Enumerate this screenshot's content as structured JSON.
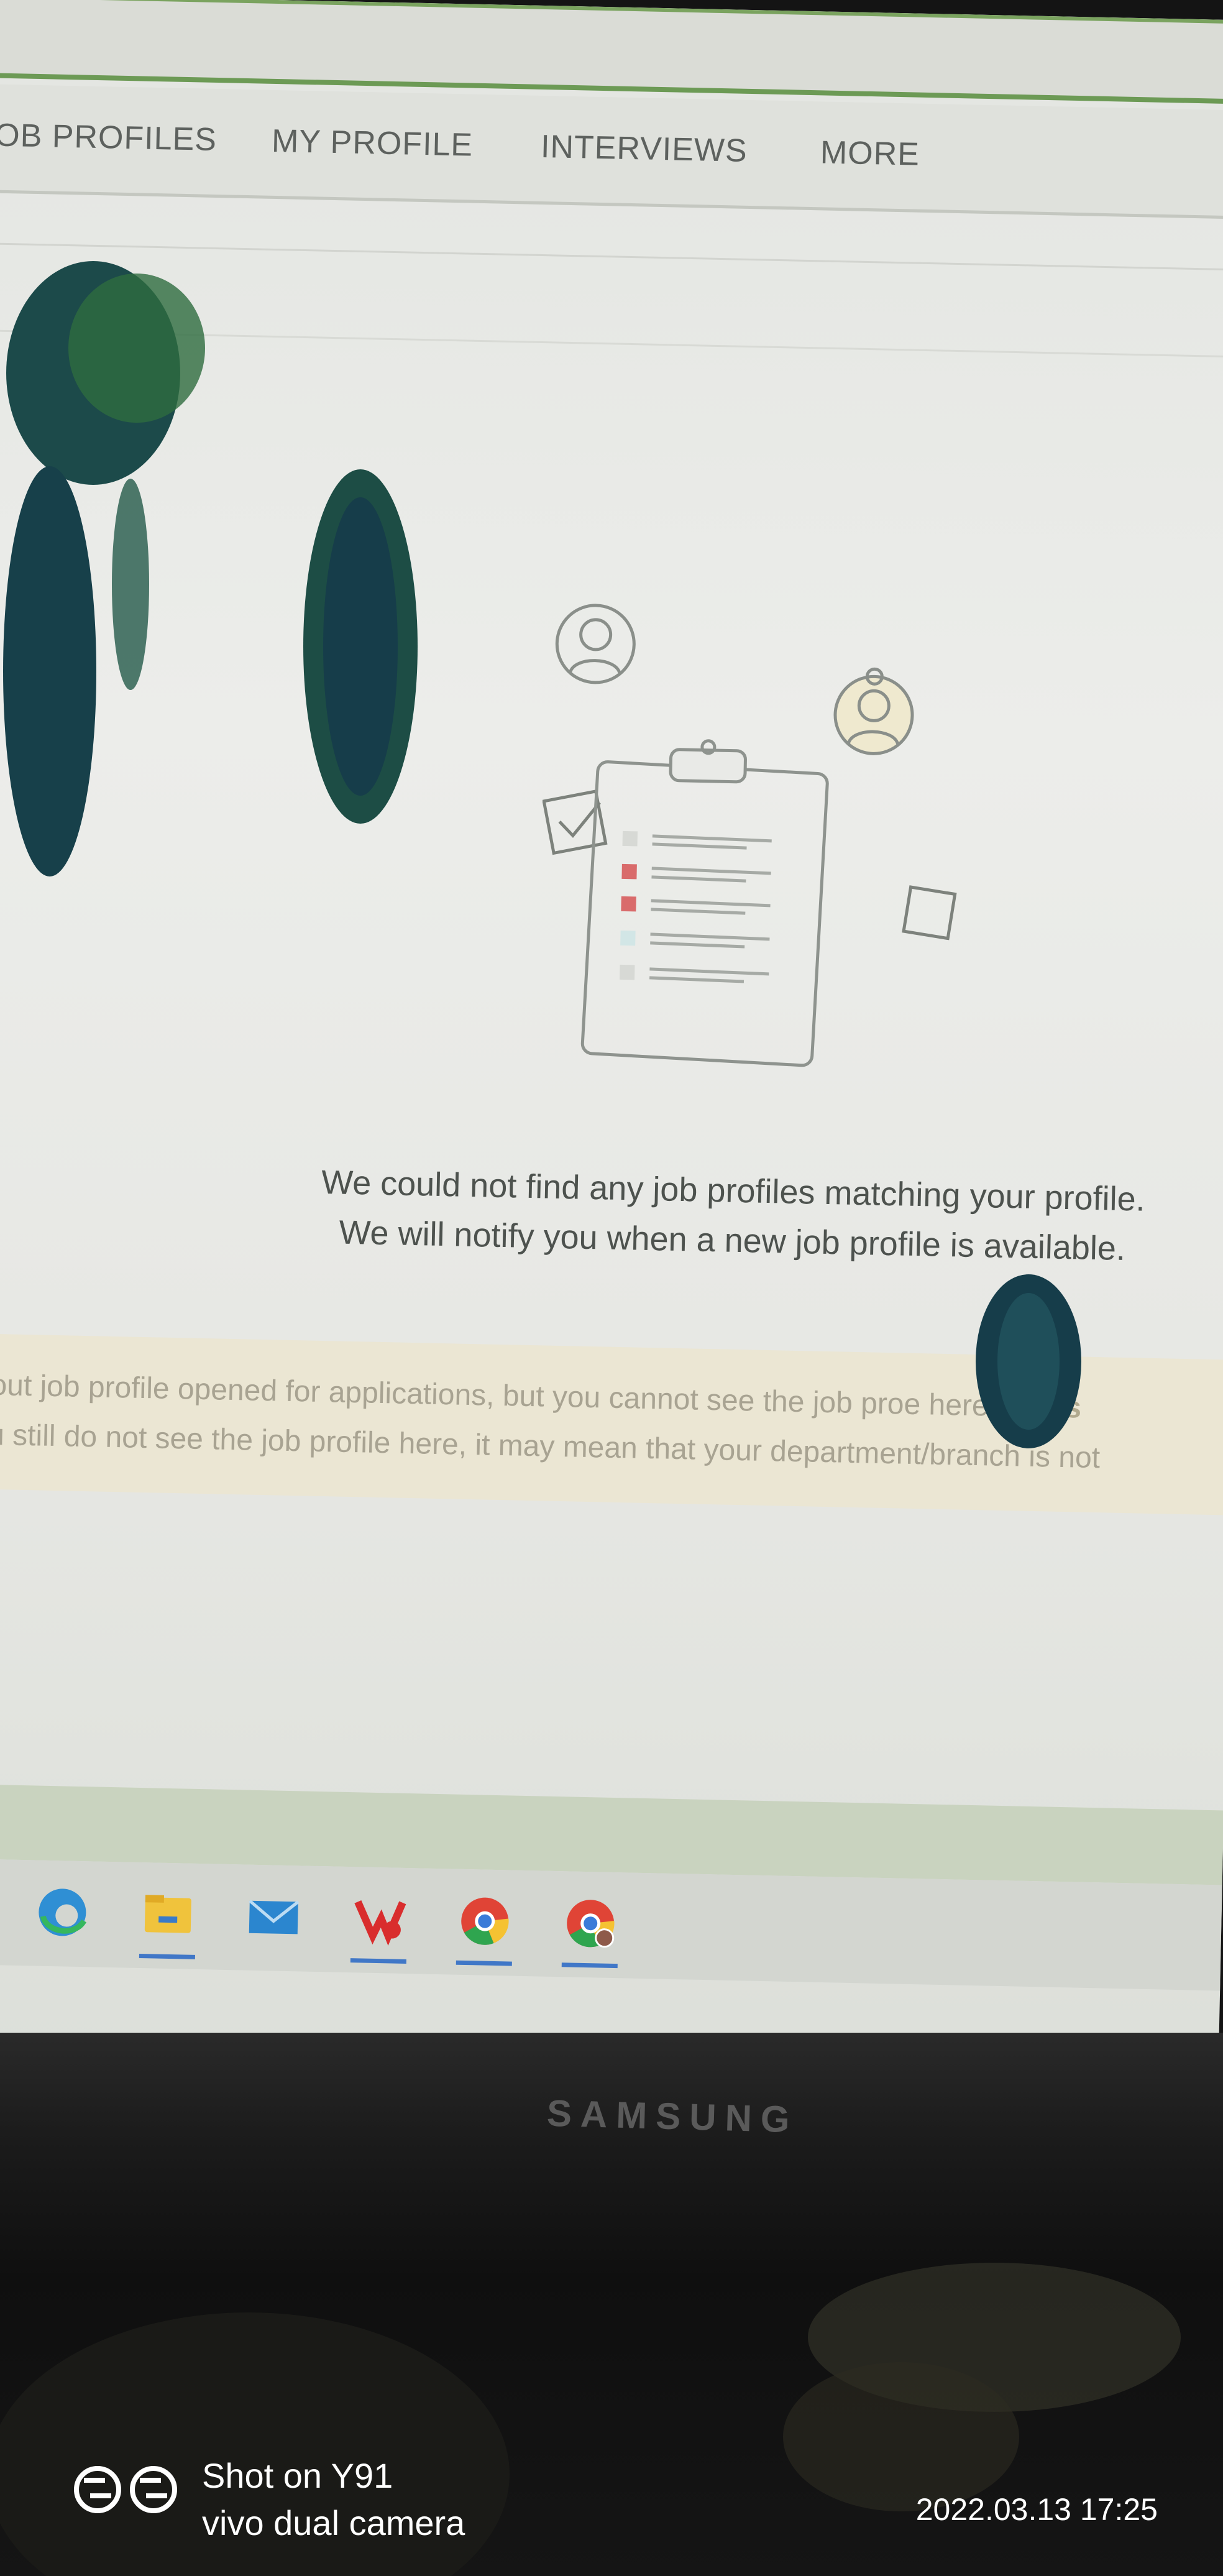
{
  "nav": {
    "items": [
      {
        "label": "OB PROFILES"
      },
      {
        "label": "MY PROFILE"
      },
      {
        "label": "INTERVIEWS"
      },
      {
        "label": "MORE"
      }
    ]
  },
  "empty_state": {
    "line1": "We could not find any job profiles matching your profile.",
    "line2": "We will notify you when a new job profile is available."
  },
  "notice": {
    "line1_text": "about job profile opened for applications, but you cannot see the job pro",
    "line1_tail": "e here,",
    "line1_bold": "pleas",
    "line2": "you still do not see the job profile here, it may mean that your department/branch is not"
  },
  "taskbar": {
    "icons": [
      "edge-icon",
      "file-explorer-icon",
      "mail-icon",
      "vlc-app-icon",
      "chrome-icon",
      "chrome-profile-icon"
    ]
  },
  "monitor": {
    "brand": "SAMSUNG"
  },
  "watermark": {
    "line1": "Shot on Y91",
    "line2": "vivo dual camera",
    "datetime": "2022.03.13 17:25"
  },
  "colors": {
    "accent_green": "#6c9a55",
    "taskbar_underline": "#4077c7",
    "check_red": "#d96b6b"
  }
}
